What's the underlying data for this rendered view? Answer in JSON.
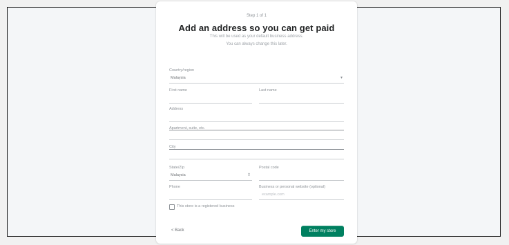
{
  "header": {
    "step": "Step 1 of 1",
    "title": "Add an address so you can get paid",
    "subtitle_line1": "This will be used as your default business address.",
    "subtitle_line2": "You can always change this later."
  },
  "form": {
    "country": {
      "label": "Country/region",
      "value": "Malaysia"
    },
    "first_name": {
      "label": "First name",
      "value": ""
    },
    "last_name": {
      "label": "Last name",
      "value": ""
    },
    "address": {
      "label": "Address",
      "value": ""
    },
    "apartment": {
      "label": "Apartment, suite, etc.",
      "value": ""
    },
    "city": {
      "label": "City",
      "value": ""
    },
    "state": {
      "label": "State/Zip",
      "value": "Malaysia"
    },
    "postal_code": {
      "label": "Postal code",
      "value": ""
    },
    "phone": {
      "label": "Phone",
      "value": ""
    },
    "business_website": {
      "label": "Business or personal website (optional)",
      "placeholder": "example.com"
    },
    "registered_business_checkbox": {
      "label": "This store is a registered business",
      "checked": false
    }
  },
  "footer": {
    "back_label": "< Back",
    "enter_store_label": "Enter my store"
  },
  "colors": {
    "primary_button": "#008060",
    "page_background": "#f4f6f8",
    "card_background": "#ffffff"
  }
}
